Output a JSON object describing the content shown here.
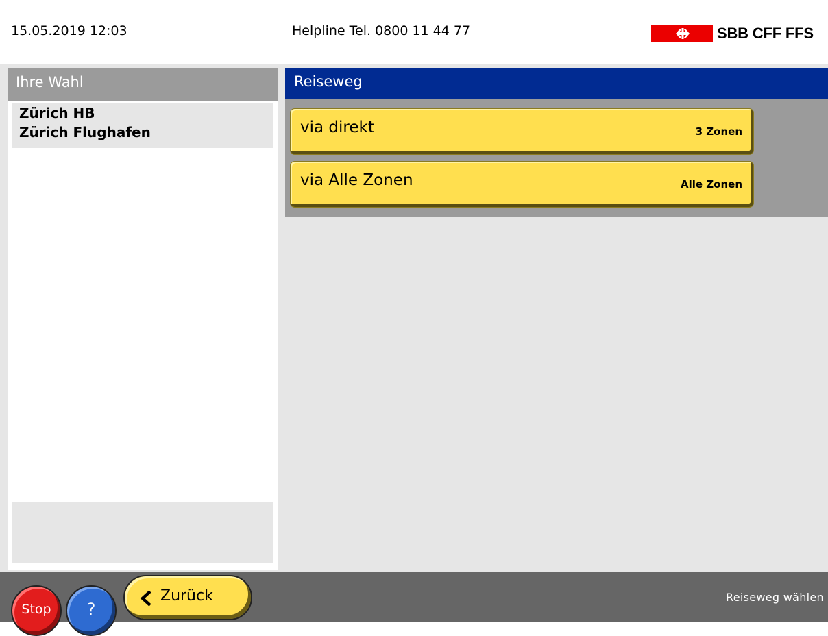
{
  "header": {
    "datetime": "15.05.2019 12:03",
    "helpline": "Helpline  Tel. 0800 11 44 77",
    "logo_text": "SBB CFF FFS",
    "logo_color": "#eb0000"
  },
  "left": {
    "title": "Ihre Wahl",
    "selection": [
      "Zürich HB",
      "Zürich Flughafen"
    ]
  },
  "right": {
    "title": "Reiseweg",
    "options": [
      {
        "label": "via direkt",
        "zones": "3 Zonen"
      },
      {
        "label": "via Alle Zonen",
        "zones": "Alle Zonen"
      }
    ]
  },
  "footer": {
    "stop_label": "Stop",
    "help_label": "?",
    "back_label": "Zurück",
    "status": "Reiseweg wählen"
  },
  "colors": {
    "accent_blue": "#012b92",
    "button_yellow": "#ffdf4f",
    "stop_red": "#e21d1d",
    "help_blue": "#2e6bd1"
  }
}
